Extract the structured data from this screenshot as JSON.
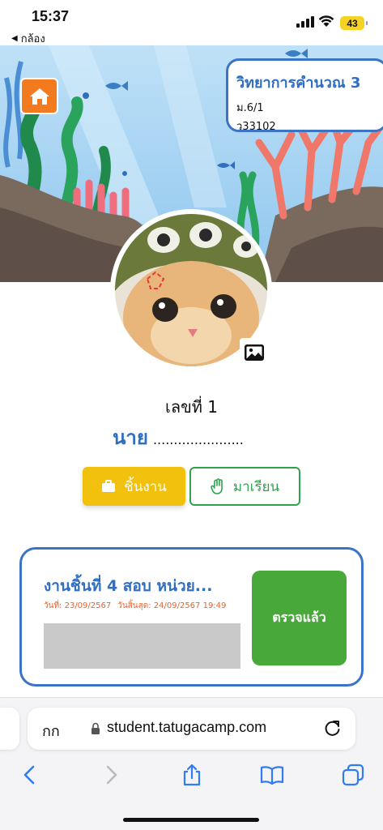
{
  "status_bar": {
    "time": "15:37",
    "back_label": "กล้อง",
    "battery": "43"
  },
  "header": {
    "home_icon": "home-icon"
  },
  "class_info": {
    "title": "วิทยาการคำนวณ 3",
    "level": "ม.6/1",
    "code": "ว33102"
  },
  "student": {
    "number_label": "เลขที่ 1",
    "name_prefix": "นาย",
    "name_value": "......................"
  },
  "actions": {
    "work_label": "ชิ้นงาน",
    "attend_label": "มาเรียน"
  },
  "work_item": {
    "title": "งานชิ้นที่ 4 สอบ หน่วย...",
    "assigned": "วันที่: 23/09/2567",
    "due": "วันสิ้นสุด: 24/09/2567 19:49",
    "status": "ตรวจแล้ว"
  },
  "browser": {
    "aa_label": "กก",
    "url": "student.tatugacamp.com"
  },
  "colors": {
    "primary_blue": "#2f6ec0",
    "accent_orange": "#f47a20",
    "work_yellow": "#f2c10e",
    "attend_green": "#2ea44f",
    "status_green": "#48a83a",
    "date_orange": "#e8622e"
  }
}
